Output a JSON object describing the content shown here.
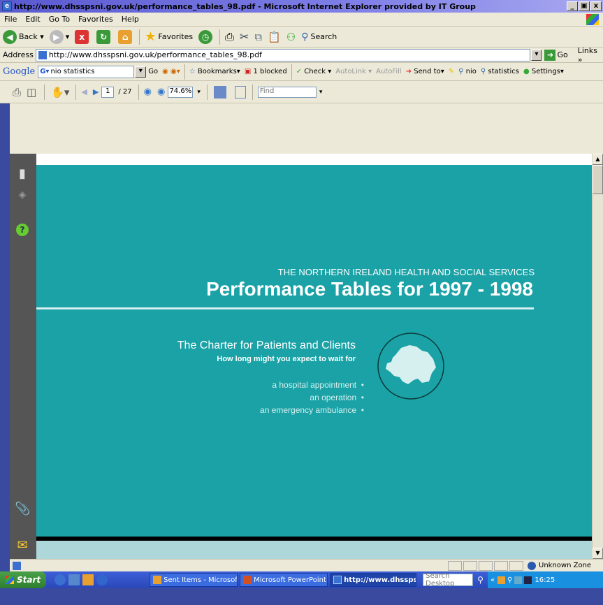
{
  "window": {
    "title": "http://www.dhsspsni.gov.uk/performance_tables_98.pdf - Microsoft Internet Explorer provided by IT Group",
    "min": "_",
    "max": " ",
    "close": "x"
  },
  "menu": [
    "File",
    "Edit",
    "Go To",
    "Favorites",
    "Help"
  ],
  "toolbar": {
    "back": "Back",
    "favorites": "Favorites",
    "search": "Search"
  },
  "address": {
    "label": "Address",
    "url": "http://www.dhsspsni.gov.uk/performance_tables_98.pdf",
    "go": "Go",
    "links": "Links"
  },
  "google": {
    "logo": "Google",
    "query": "nio statistics",
    "go": "Go",
    "bookmarks": "Bookmarks",
    "blocked": "1 blocked",
    "check": "Check",
    "autolink": "AutoLink",
    "autofill": "AutoFill",
    "sendto": "Send to",
    "nio": "nio",
    "statistics": "statistics",
    "settings": "Settings"
  },
  "pdf": {
    "page": "1",
    "total": "/ 27",
    "zoom": "74.6%",
    "find": "Find",
    "subtitle": "THE NORTHERN IRELAND HEALTH AND SOCIAL SERVICES",
    "title": "Performance Tables for 1997 - 1998",
    "charter": "The Charter for Patients and Clients",
    "wait": "How long might you expect to wait for",
    "items": [
      "a hospital appointment",
      "an operation",
      "an emergency ambulance"
    ]
  },
  "status": {
    "zone": "Unknown Zone"
  },
  "taskbar": {
    "start": "Start",
    "tasks": [
      "Sent Items - Microsoft ...",
      "Microsoft PowerPoint - ...",
      "http://www.dhsspsn..."
    ],
    "search": "Search Desktop",
    "clock": "16:25"
  }
}
